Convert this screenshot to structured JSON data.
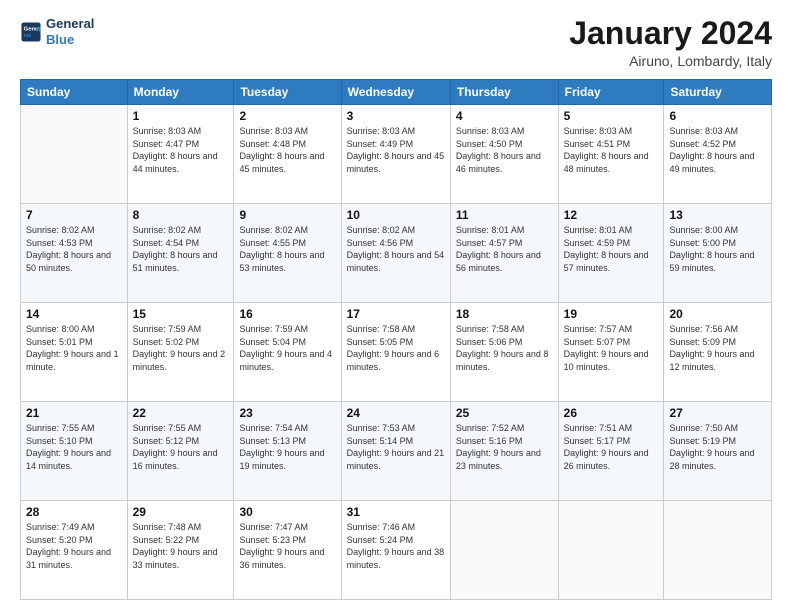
{
  "logo": {
    "line1": "General",
    "line2": "Blue"
  },
  "header": {
    "title": "January 2024",
    "location": "Airuno, Lombardy, Italy"
  },
  "weekdays": [
    "Sunday",
    "Monday",
    "Tuesday",
    "Wednesday",
    "Thursday",
    "Friday",
    "Saturday"
  ],
  "weeks": [
    [
      {
        "day": "",
        "sunrise": "",
        "sunset": "",
        "daylight": ""
      },
      {
        "day": "1",
        "sunrise": "Sunrise: 8:03 AM",
        "sunset": "Sunset: 4:47 PM",
        "daylight": "Daylight: 8 hours and 44 minutes."
      },
      {
        "day": "2",
        "sunrise": "Sunrise: 8:03 AM",
        "sunset": "Sunset: 4:48 PM",
        "daylight": "Daylight: 8 hours and 45 minutes."
      },
      {
        "day": "3",
        "sunrise": "Sunrise: 8:03 AM",
        "sunset": "Sunset: 4:49 PM",
        "daylight": "Daylight: 8 hours and 45 minutes."
      },
      {
        "day": "4",
        "sunrise": "Sunrise: 8:03 AM",
        "sunset": "Sunset: 4:50 PM",
        "daylight": "Daylight: 8 hours and 46 minutes."
      },
      {
        "day": "5",
        "sunrise": "Sunrise: 8:03 AM",
        "sunset": "Sunset: 4:51 PM",
        "daylight": "Daylight: 8 hours and 48 minutes."
      },
      {
        "day": "6",
        "sunrise": "Sunrise: 8:03 AM",
        "sunset": "Sunset: 4:52 PM",
        "daylight": "Daylight: 8 hours and 49 minutes."
      }
    ],
    [
      {
        "day": "7",
        "sunrise": "Sunrise: 8:02 AM",
        "sunset": "Sunset: 4:53 PM",
        "daylight": "Daylight: 8 hours and 50 minutes."
      },
      {
        "day": "8",
        "sunrise": "Sunrise: 8:02 AM",
        "sunset": "Sunset: 4:54 PM",
        "daylight": "Daylight: 8 hours and 51 minutes."
      },
      {
        "day": "9",
        "sunrise": "Sunrise: 8:02 AM",
        "sunset": "Sunset: 4:55 PM",
        "daylight": "Daylight: 8 hours and 53 minutes."
      },
      {
        "day": "10",
        "sunrise": "Sunrise: 8:02 AM",
        "sunset": "Sunset: 4:56 PM",
        "daylight": "Daylight: 8 hours and 54 minutes."
      },
      {
        "day": "11",
        "sunrise": "Sunrise: 8:01 AM",
        "sunset": "Sunset: 4:57 PM",
        "daylight": "Daylight: 8 hours and 56 minutes."
      },
      {
        "day": "12",
        "sunrise": "Sunrise: 8:01 AM",
        "sunset": "Sunset: 4:59 PM",
        "daylight": "Daylight: 8 hours and 57 minutes."
      },
      {
        "day": "13",
        "sunrise": "Sunrise: 8:00 AM",
        "sunset": "Sunset: 5:00 PM",
        "daylight": "Daylight: 8 hours and 59 minutes."
      }
    ],
    [
      {
        "day": "14",
        "sunrise": "Sunrise: 8:00 AM",
        "sunset": "Sunset: 5:01 PM",
        "daylight": "Daylight: 9 hours and 1 minute."
      },
      {
        "day": "15",
        "sunrise": "Sunrise: 7:59 AM",
        "sunset": "Sunset: 5:02 PM",
        "daylight": "Daylight: 9 hours and 2 minutes."
      },
      {
        "day": "16",
        "sunrise": "Sunrise: 7:59 AM",
        "sunset": "Sunset: 5:04 PM",
        "daylight": "Daylight: 9 hours and 4 minutes."
      },
      {
        "day": "17",
        "sunrise": "Sunrise: 7:58 AM",
        "sunset": "Sunset: 5:05 PM",
        "daylight": "Daylight: 9 hours and 6 minutes."
      },
      {
        "day": "18",
        "sunrise": "Sunrise: 7:58 AM",
        "sunset": "Sunset: 5:06 PM",
        "daylight": "Daylight: 9 hours and 8 minutes."
      },
      {
        "day": "19",
        "sunrise": "Sunrise: 7:57 AM",
        "sunset": "Sunset: 5:07 PM",
        "daylight": "Daylight: 9 hours and 10 minutes."
      },
      {
        "day": "20",
        "sunrise": "Sunrise: 7:56 AM",
        "sunset": "Sunset: 5:09 PM",
        "daylight": "Daylight: 9 hours and 12 minutes."
      }
    ],
    [
      {
        "day": "21",
        "sunrise": "Sunrise: 7:55 AM",
        "sunset": "Sunset: 5:10 PM",
        "daylight": "Daylight: 9 hours and 14 minutes."
      },
      {
        "day": "22",
        "sunrise": "Sunrise: 7:55 AM",
        "sunset": "Sunset: 5:12 PM",
        "daylight": "Daylight: 9 hours and 16 minutes."
      },
      {
        "day": "23",
        "sunrise": "Sunrise: 7:54 AM",
        "sunset": "Sunset: 5:13 PM",
        "daylight": "Daylight: 9 hours and 19 minutes."
      },
      {
        "day": "24",
        "sunrise": "Sunrise: 7:53 AM",
        "sunset": "Sunset: 5:14 PM",
        "daylight": "Daylight: 9 hours and 21 minutes."
      },
      {
        "day": "25",
        "sunrise": "Sunrise: 7:52 AM",
        "sunset": "Sunset: 5:16 PM",
        "daylight": "Daylight: 9 hours and 23 minutes."
      },
      {
        "day": "26",
        "sunrise": "Sunrise: 7:51 AM",
        "sunset": "Sunset: 5:17 PM",
        "daylight": "Daylight: 9 hours and 26 minutes."
      },
      {
        "day": "27",
        "sunrise": "Sunrise: 7:50 AM",
        "sunset": "Sunset: 5:19 PM",
        "daylight": "Daylight: 9 hours and 28 minutes."
      }
    ],
    [
      {
        "day": "28",
        "sunrise": "Sunrise: 7:49 AM",
        "sunset": "Sunset: 5:20 PM",
        "daylight": "Daylight: 9 hours and 31 minutes."
      },
      {
        "day": "29",
        "sunrise": "Sunrise: 7:48 AM",
        "sunset": "Sunset: 5:22 PM",
        "daylight": "Daylight: 9 hours and 33 minutes."
      },
      {
        "day": "30",
        "sunrise": "Sunrise: 7:47 AM",
        "sunset": "Sunset: 5:23 PM",
        "daylight": "Daylight: 9 hours and 36 minutes."
      },
      {
        "day": "31",
        "sunrise": "Sunrise: 7:46 AM",
        "sunset": "Sunset: 5:24 PM",
        "daylight": "Daylight: 9 hours and 38 minutes."
      },
      {
        "day": "",
        "sunrise": "",
        "sunset": "",
        "daylight": ""
      },
      {
        "day": "",
        "sunrise": "",
        "sunset": "",
        "daylight": ""
      },
      {
        "day": "",
        "sunrise": "",
        "sunset": "",
        "daylight": ""
      }
    ]
  ]
}
